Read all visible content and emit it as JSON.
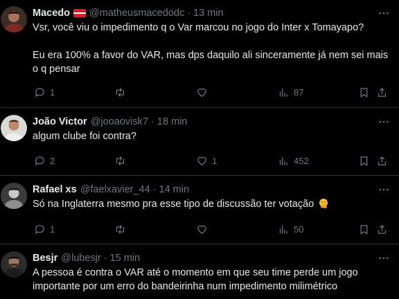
{
  "tweets": [
    {
      "name": "Macedo",
      "handle": "@matheusmacedodc",
      "dot": "·",
      "time": "13 min",
      "has_flag": true,
      "paragraphs": [
        "Vsr, você viu o impedimento q o Var marcou no jogo do Inter x Tomayapo?",
        "Eu era 100% a favor do VAR, mas dps daquilo ali sinceramente já nem sei mais o q pensar"
      ],
      "replies": "1",
      "retweets": "",
      "likes": "",
      "views": "87"
    },
    {
      "name": "João Victor",
      "handle": "@jooaovisk7",
      "dot": "·",
      "time": "18 min",
      "paragraphs": [
        "algum clube foi contra?"
      ],
      "replies": "2",
      "retweets": "",
      "likes": "1",
      "views": "452"
    },
    {
      "name": "Rafael xs",
      "handle": "@faelxavier_44",
      "dot": "·",
      "time": "14 min",
      "paragraphs": [
        "Só na Inglaterra mesmo pra esse tipo de discussão ter votação"
      ],
      "emoji": "face-with-hand-over-mouth",
      "replies": "1",
      "retweets": "",
      "likes": "",
      "views": "50"
    },
    {
      "name": "Besjr",
      "handle": "@lubesjr",
      "dot": "·",
      "time": "15 min",
      "paragraphs": [
        "A pessoa é contra o VAR até o momento em que seu time perde um jogo importante por um erro do bandeirinha num impedimento milimétrico"
      ]
    }
  ],
  "colors": {
    "background": "#000000",
    "text": "#e7e9ea",
    "muted": "#71767b",
    "divider": "#2f3336",
    "flag_red": "#d4202b"
  },
  "icons": [
    "more-icon",
    "reply-icon",
    "retweet-icon",
    "like-icon",
    "views-icon",
    "bookmark-icon",
    "share-icon"
  ]
}
